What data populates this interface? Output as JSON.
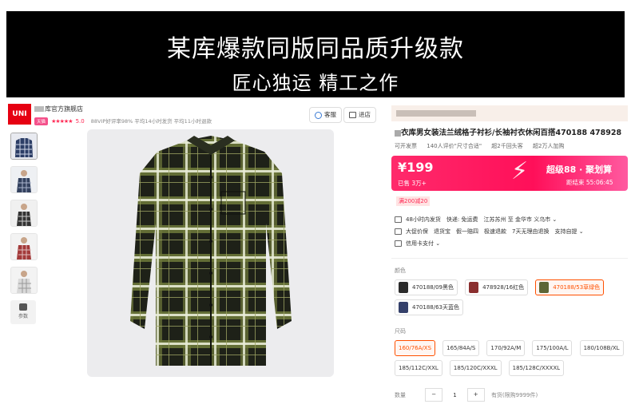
{
  "banner": {
    "line1": "某库爆款同版同品质升级款",
    "line2": "匠心独运 精工之作"
  },
  "shop": {
    "logo_text": "UNI",
    "name": "库官方旗舰店",
    "badge": "天猫",
    "stars": "★★★★★",
    "score": "5.0",
    "meta": "88VIP好评率98%   平均14小时发货   平均11小时退款"
  },
  "toolbar": {
    "service_label": "客服",
    "store_label": "进店"
  },
  "gallery": {
    "params_label": "参数"
  },
  "product": {
    "title": "衣库男女装法兰绒格子衬衫/长袖衬衣休闲百搭470188 478928",
    "tags": [
      "可开发票",
      "140人评价\"尺寸合适\"",
      "超2千回头客",
      "超2万人加购"
    ],
    "price": "¥199",
    "sold": "已售 3万+",
    "activity": "超级88 · 聚划算",
    "countdown": "距结束 55:06:45",
    "coupon": "满200减20"
  },
  "services": [
    [
      "48小时内发货",
      "快递: 免运费",
      "江苏苏州 至 金华市 义乌市 ⌄"
    ],
    [
      "大促价保",
      "退货宝",
      "假一赔四",
      "极速退款",
      "7天无理由退换",
      "支持自提 ⌄"
    ],
    [
      "信用卡支付 ⌄"
    ]
  ],
  "colors": {
    "label": "颜色",
    "options": [
      "470188/09黑色",
      "478928/16红色",
      "470188/53草绿色",
      "470188/63天蓝色"
    ]
  },
  "sizes": {
    "label": "尺码",
    "options": [
      "160/76A/XS",
      "165/84A/S",
      "170/92A/M",
      "175/100A/L",
      "180/108B/XL",
      "185/112C/XXL",
      "185/120C/XXXL",
      "185/128C/XXXXL"
    ]
  },
  "quantity": {
    "label": "数量",
    "minus": "−",
    "value": "1",
    "plus": "+",
    "stock": "有货(限购9999件)"
  },
  "theme": {
    "accent": "#ff2a55",
    "selected": "#ff5000",
    "banner_bg": "#000000"
  }
}
